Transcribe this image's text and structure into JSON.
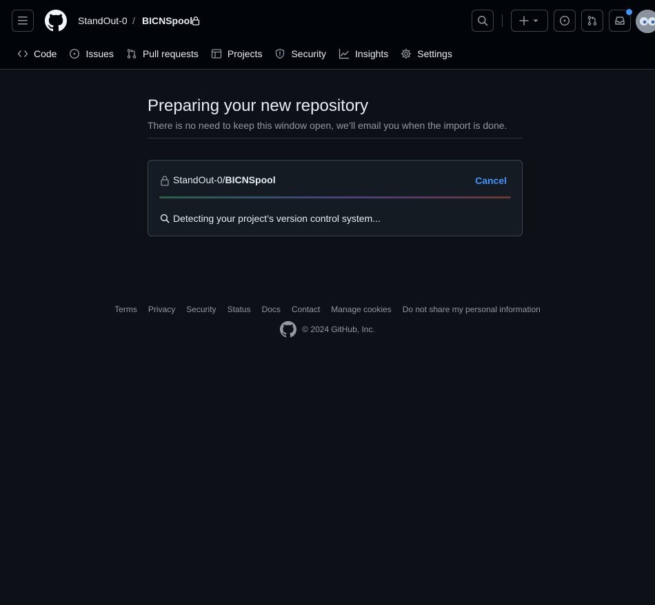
{
  "header": {
    "owner": "StandOut-0",
    "separator": "/",
    "repo": "BICNSpool",
    "icons": {
      "menu": "hamburger-icon",
      "logo": "github-mark-icon",
      "lock": "lock-icon",
      "search": "search-icon",
      "create": "plus-icon",
      "issues": "issue-opened-icon",
      "pulls": "git-pull-request-icon",
      "inbox": "inbox-icon"
    }
  },
  "tabs": [
    {
      "label": "Code",
      "icon": "code-icon"
    },
    {
      "label": "Issues",
      "icon": "issue-opened-icon"
    },
    {
      "label": "Pull requests",
      "icon": "git-pull-request-icon"
    },
    {
      "label": "Projects",
      "icon": "table-icon"
    },
    {
      "label": "Security",
      "icon": "shield-icon"
    },
    {
      "label": "Insights",
      "icon": "graph-icon"
    },
    {
      "label": "Settings",
      "icon": "gear-icon"
    }
  ],
  "main": {
    "title": "Preparing your new repository",
    "subtitle": "There is no need to keep this window open, we’ll email you when the import is done."
  },
  "import": {
    "owner_prefix": "StandOut-0/",
    "repo_name": "BICNSpool",
    "cancel_label": "Cancel",
    "progress": 1.0,
    "status": "Detecting your project’s version control system..."
  },
  "footer": {
    "links": [
      "Terms",
      "Privacy",
      "Security",
      "Status",
      "Docs",
      "Contact",
      "Manage cookies",
      "Do not share my personal information"
    ],
    "copyright": "© 2024 GitHub, Inc."
  },
  "colors": {
    "background": "#0d1117",
    "header_bg": "#010409",
    "accent_link": "#4493f8",
    "muted_text": "#9198a1"
  }
}
